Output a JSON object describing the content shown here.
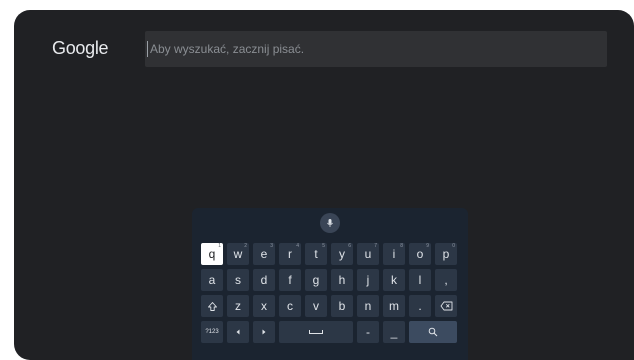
{
  "brand": {
    "logo_text": "Google"
  },
  "search": {
    "placeholder": "Aby wyszukać, zacznij pisać."
  },
  "keyboard": {
    "row1": [
      {
        "label": "q",
        "num": "1"
      },
      {
        "label": "w",
        "num": "2"
      },
      {
        "label": "e",
        "num": "3"
      },
      {
        "label": "r",
        "num": "4"
      },
      {
        "label": "t",
        "num": "5"
      },
      {
        "label": "y",
        "num": "6"
      },
      {
        "label": "u",
        "num": "7"
      },
      {
        "label": "i",
        "num": "8"
      },
      {
        "label": "o",
        "num": "9"
      },
      {
        "label": "p",
        "num": "0"
      }
    ],
    "row2": [
      "a",
      "s",
      "d",
      "f",
      "g",
      "h",
      "j",
      "k",
      "l",
      ","
    ],
    "row3": [
      "z",
      "x",
      "c",
      "v",
      "b",
      "n",
      "m",
      "."
    ],
    "symbols_label": "?123",
    "dash_label": "-",
    "underscore_label": "_",
    "focused_key": "q"
  },
  "colors": {
    "background": "#202124",
    "keyboard": "#1b2430",
    "key": "#2c3746",
    "focused_key": "#ffffff"
  }
}
